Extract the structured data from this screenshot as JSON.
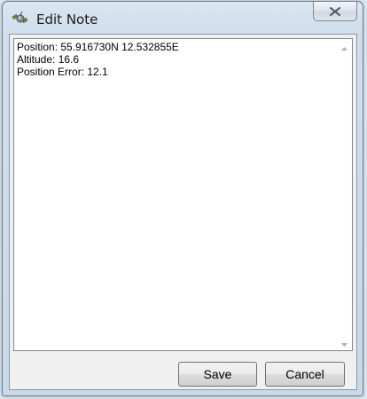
{
  "window": {
    "title": "Edit Note",
    "icon": "satellite-icon",
    "close_icon": "close-icon"
  },
  "note": {
    "lines": [
      "Position: 55.916730N 12.532855E",
      "Altitude: 16.6",
      "Position Error: 12.1"
    ]
  },
  "buttons": {
    "save_label": "Save",
    "cancel_label": "Cancel"
  },
  "colors": {
    "window_frame": "#c9d9e8",
    "client_bg": "#f0f0f0",
    "text_area_bg": "#ffffff"
  }
}
